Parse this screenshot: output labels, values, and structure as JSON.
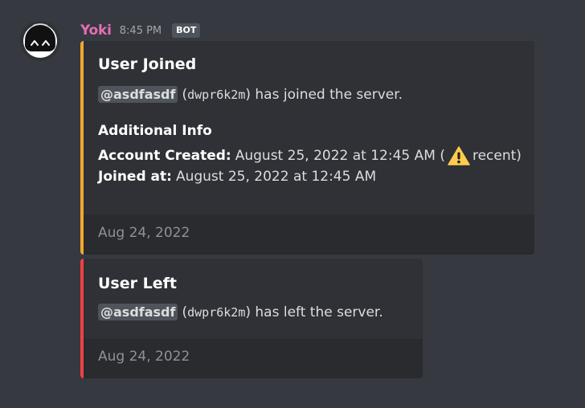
{
  "message": {
    "author": "Yoki",
    "timestamp": "8:45 PM",
    "bot_tag": "BOT",
    "avatar_icon": "robot-face-icon",
    "author_color": "#e46eb5"
  },
  "embeds": [
    {
      "accent_color": "#f0a732",
      "title": "User Joined",
      "mention": "@asdfasdf",
      "open_paren": "(",
      "user_id": "dwpr6k2m",
      "close_rest": ") has joined the server.",
      "additional_info_heading": "Additional Info",
      "account_created_label": "Account Created:",
      "account_created_value": "August 25, 2022 at 12:45 AM (",
      "warning_icon": "warning-icon",
      "recent_text": "recent)",
      "joined_at_label": "Joined at:",
      "joined_at_value": "August 25, 2022 at 12:45 AM",
      "footer": "Aug 24, 2022"
    },
    {
      "accent_color": "#ed4245",
      "title": "User Left",
      "mention": "@asdfasdf",
      "open_paren": "(",
      "user_id": "dwpr6k2m",
      "close_rest": ") has left the server.",
      "footer": "Aug 24, 2022"
    }
  ]
}
